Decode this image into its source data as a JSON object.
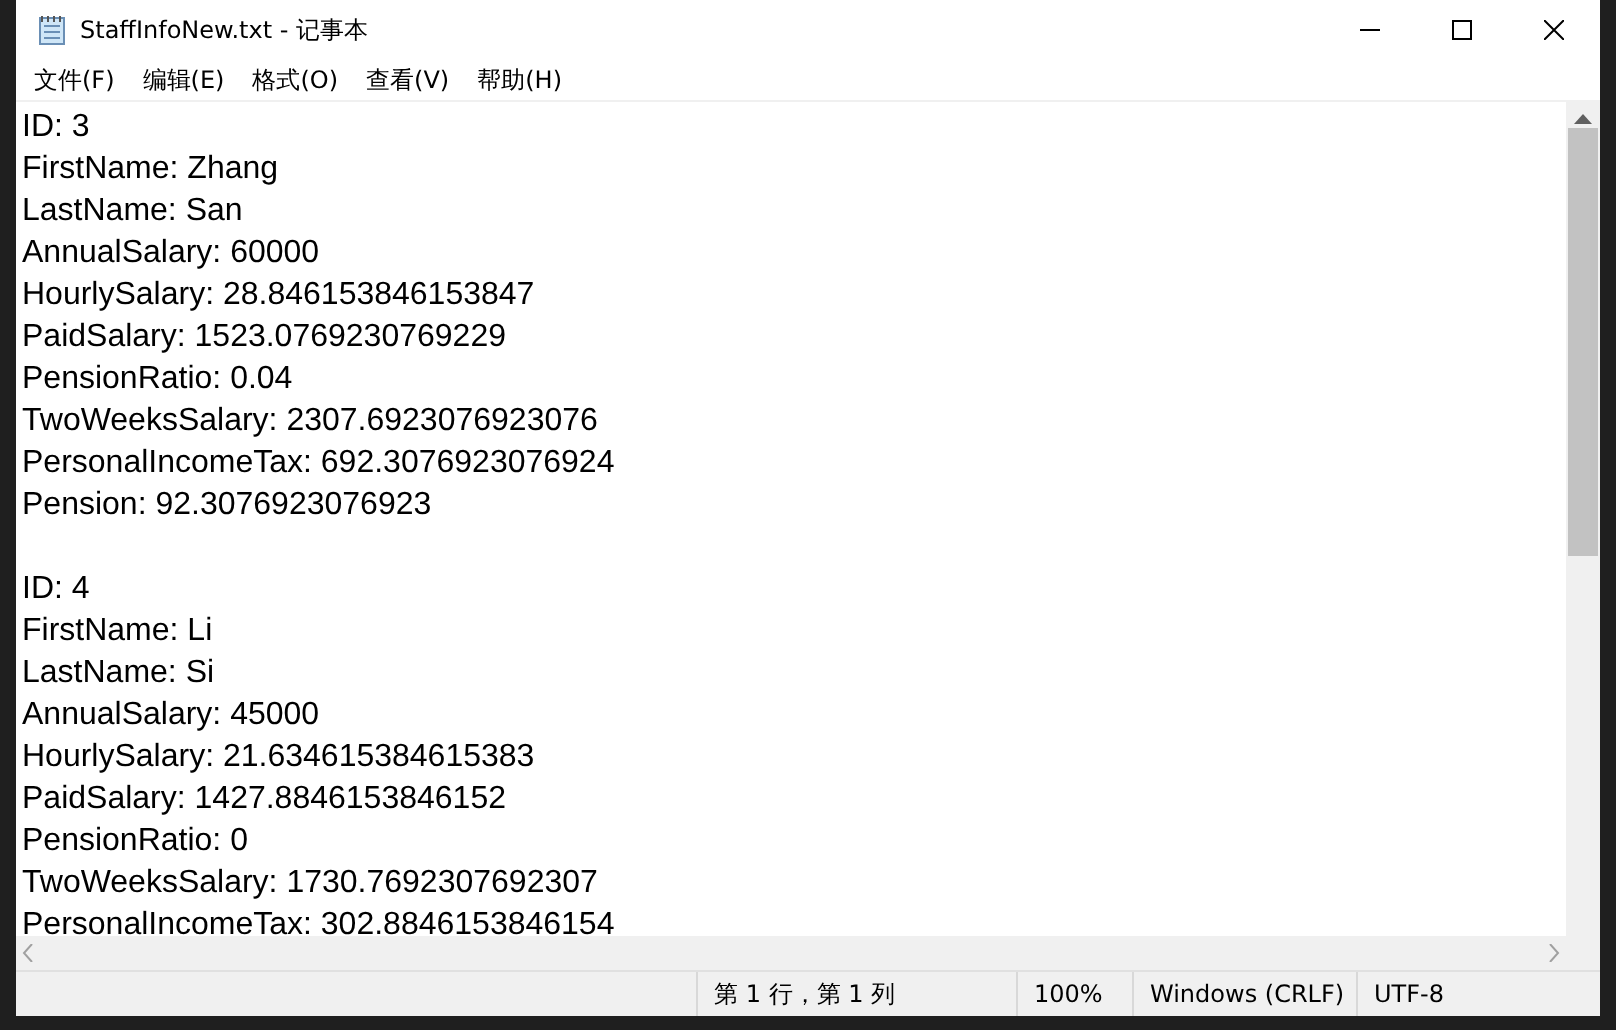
{
  "window": {
    "title": "StaffInfoNew.txt - 记事本"
  },
  "menu": [
    "文件(F)",
    "编辑(E)",
    "格式(O)",
    "查看(V)",
    "帮助(H)"
  ],
  "records": [
    {
      "lines": [
        "ID: 3",
        "FirstName: Zhang",
        "LastName: San",
        "AnnualSalary: 60000",
        "HourlySalary: 28.846153846153847",
        "PaidSalary: 1523.0769230769229",
        "PensionRatio: 0.04",
        "TwoWeeksSalary: 2307.6923076923076",
        "PersonalIncomeTax: 692.3076923076924",
        "Pension: 92.3076923076923"
      ]
    },
    {
      "lines": [
        "ID: 4",
        "FirstName: Li",
        "LastName: Si",
        "AnnualSalary: 45000",
        "HourlySalary: 21.634615384615383",
        "PaidSalary: 1427.8846153846152",
        "PensionRatio: 0",
        "TwoWeeksSalary: 1730.7692307692307",
        "PersonalIncomeTax: 302.8846153846154"
      ]
    }
  ],
  "status_bar": [
    "第 1 行，第 1 列",
    "100%",
    "Windows (CRLF)",
    "UTF-8"
  ]
}
